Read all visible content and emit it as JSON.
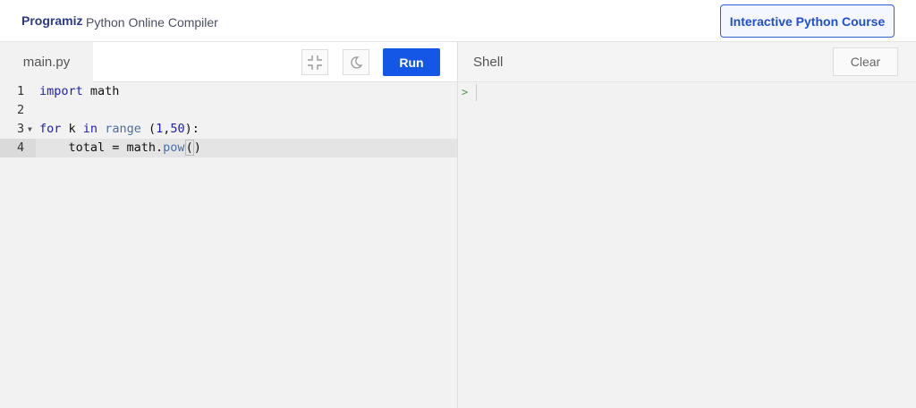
{
  "header": {
    "logo": "Programiz",
    "title": "Python Online Compiler",
    "course_button": "Interactive Python Course"
  },
  "editor": {
    "tab": "main.py",
    "run_label": "Run",
    "lines": [
      {
        "n": "1"
      },
      {
        "n": "2"
      },
      {
        "n": "3"
      },
      {
        "n": "4"
      }
    ]
  },
  "shell": {
    "title": "Shell",
    "clear_label": "Clear",
    "prompt": ">"
  }
}
